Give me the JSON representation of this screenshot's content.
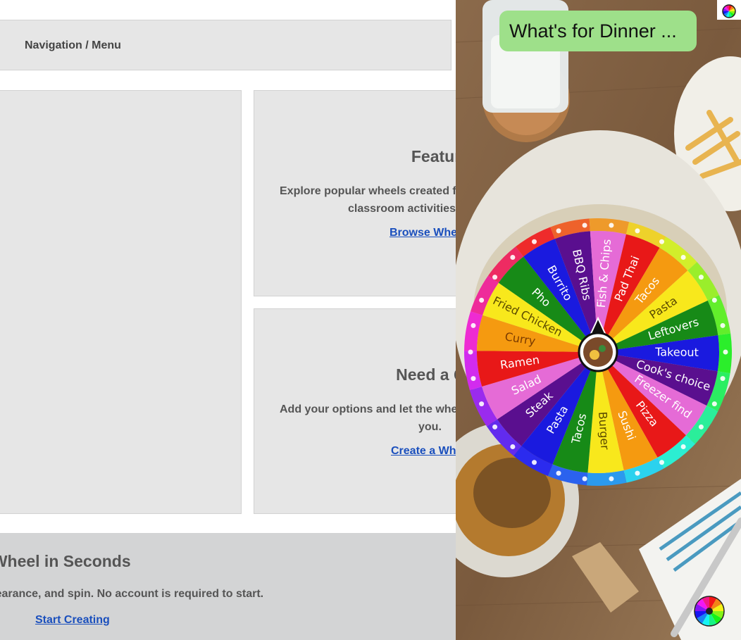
{
  "nav": {
    "label": "Navigation / Menu"
  },
  "card1": {
    "title": "Featured W",
    "desc_line1": "Explore popular wheels created f",
    "desc_line2": "classroom activities,",
    "link": "Browse Whe"
  },
  "card2": {
    "title": "Need a Quick D",
    "desc_line1": "Add your options and let the whe",
    "desc_line2": "you.",
    "link": "Create a Wh"
  },
  "bottom": {
    "title": "ate a Wheel in Seconds",
    "desc": "he appearance, and spin. No account is required to start.",
    "link": "Start Creating"
  },
  "overlay": {
    "title": "What's for Dinner ...",
    "wheel_segments": [
      {
        "label": "Takeout",
        "color": "#1a1adf",
        "text": "#ffffff"
      },
      {
        "label": "Cook's choice",
        "color": "#5a0f8f",
        "text": "#ffffff"
      },
      {
        "label": "Freezer find",
        "color": "#e56bd6",
        "text": "#ffffff"
      },
      {
        "label": "Pizza",
        "color": "#e81818",
        "text": "#ffffff"
      },
      {
        "label": "Sushi",
        "color": "#f59a10",
        "text": "#ffffff"
      },
      {
        "label": "Burger",
        "color": "#f8e81c",
        "text": "#5a4a00"
      },
      {
        "label": "Tacos",
        "color": "#178a17",
        "text": "#ffffff"
      },
      {
        "label": "Pasta",
        "color": "#1a1adf",
        "text": "#ffffff"
      },
      {
        "label": "Steak",
        "color": "#5a0f8f",
        "text": "#ffffff"
      },
      {
        "label": "Salad",
        "color": "#e56bd6",
        "text": "#ffffff"
      },
      {
        "label": "Ramen",
        "color": "#e81818",
        "text": "#ffffff"
      },
      {
        "label": "Curry",
        "color": "#f59a10",
        "text": "#7a3a00"
      },
      {
        "label": "Fried Chicken",
        "color": "#f8e81c",
        "text": "#5a4a00"
      },
      {
        "label": "Pho",
        "color": "#178a17",
        "text": "#ffffff"
      },
      {
        "label": "Burrito",
        "color": "#1a1adf",
        "text": "#ffffff"
      },
      {
        "label": "BBQ Ribs",
        "color": "#5a0f8f",
        "text": "#ffffff"
      },
      {
        "label": "Fish & Chips",
        "color": "#e56bd6",
        "text": "#ffffff"
      },
      {
        "label": "Pad Thai",
        "color": "#e81818",
        "text": "#ffffff"
      },
      {
        "label": "Tacos",
        "color": "#f59a10",
        "text": "#ffffff"
      },
      {
        "label": "Pasta",
        "color": "#f8e81c",
        "text": "#5a4a00"
      },
      {
        "label": "Leftovers",
        "color": "#178a17",
        "text": "#ffffff"
      }
    ]
  }
}
